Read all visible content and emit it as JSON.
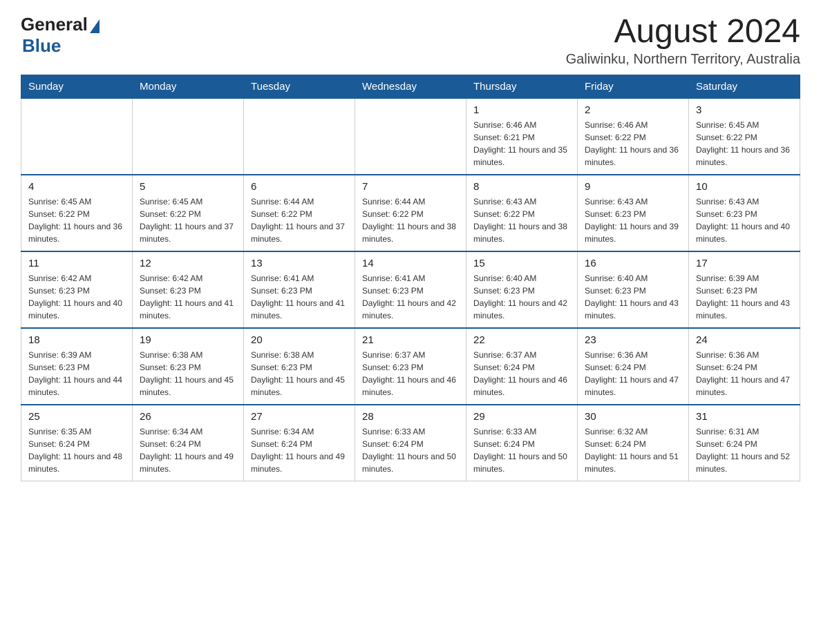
{
  "logo": {
    "general": "General",
    "blue": "Blue"
  },
  "title": {
    "month_year": "August 2024",
    "location": "Galiwinku, Northern Territory, Australia"
  },
  "headers": [
    "Sunday",
    "Monday",
    "Tuesday",
    "Wednesday",
    "Thursday",
    "Friday",
    "Saturday"
  ],
  "weeks": [
    [
      {
        "day": "",
        "info": ""
      },
      {
        "day": "",
        "info": ""
      },
      {
        "day": "",
        "info": ""
      },
      {
        "day": "",
        "info": ""
      },
      {
        "day": "1",
        "info": "Sunrise: 6:46 AM\nSunset: 6:21 PM\nDaylight: 11 hours and 35 minutes."
      },
      {
        "day": "2",
        "info": "Sunrise: 6:46 AM\nSunset: 6:22 PM\nDaylight: 11 hours and 36 minutes."
      },
      {
        "day": "3",
        "info": "Sunrise: 6:45 AM\nSunset: 6:22 PM\nDaylight: 11 hours and 36 minutes."
      }
    ],
    [
      {
        "day": "4",
        "info": "Sunrise: 6:45 AM\nSunset: 6:22 PM\nDaylight: 11 hours and 36 minutes."
      },
      {
        "day": "5",
        "info": "Sunrise: 6:45 AM\nSunset: 6:22 PM\nDaylight: 11 hours and 37 minutes."
      },
      {
        "day": "6",
        "info": "Sunrise: 6:44 AM\nSunset: 6:22 PM\nDaylight: 11 hours and 37 minutes."
      },
      {
        "day": "7",
        "info": "Sunrise: 6:44 AM\nSunset: 6:22 PM\nDaylight: 11 hours and 38 minutes."
      },
      {
        "day": "8",
        "info": "Sunrise: 6:43 AM\nSunset: 6:22 PM\nDaylight: 11 hours and 38 minutes."
      },
      {
        "day": "9",
        "info": "Sunrise: 6:43 AM\nSunset: 6:23 PM\nDaylight: 11 hours and 39 minutes."
      },
      {
        "day": "10",
        "info": "Sunrise: 6:43 AM\nSunset: 6:23 PM\nDaylight: 11 hours and 40 minutes."
      }
    ],
    [
      {
        "day": "11",
        "info": "Sunrise: 6:42 AM\nSunset: 6:23 PM\nDaylight: 11 hours and 40 minutes."
      },
      {
        "day": "12",
        "info": "Sunrise: 6:42 AM\nSunset: 6:23 PM\nDaylight: 11 hours and 41 minutes."
      },
      {
        "day": "13",
        "info": "Sunrise: 6:41 AM\nSunset: 6:23 PM\nDaylight: 11 hours and 41 minutes."
      },
      {
        "day": "14",
        "info": "Sunrise: 6:41 AM\nSunset: 6:23 PM\nDaylight: 11 hours and 42 minutes."
      },
      {
        "day": "15",
        "info": "Sunrise: 6:40 AM\nSunset: 6:23 PM\nDaylight: 11 hours and 42 minutes."
      },
      {
        "day": "16",
        "info": "Sunrise: 6:40 AM\nSunset: 6:23 PM\nDaylight: 11 hours and 43 minutes."
      },
      {
        "day": "17",
        "info": "Sunrise: 6:39 AM\nSunset: 6:23 PM\nDaylight: 11 hours and 43 minutes."
      }
    ],
    [
      {
        "day": "18",
        "info": "Sunrise: 6:39 AM\nSunset: 6:23 PM\nDaylight: 11 hours and 44 minutes."
      },
      {
        "day": "19",
        "info": "Sunrise: 6:38 AM\nSunset: 6:23 PM\nDaylight: 11 hours and 45 minutes."
      },
      {
        "day": "20",
        "info": "Sunrise: 6:38 AM\nSunset: 6:23 PM\nDaylight: 11 hours and 45 minutes."
      },
      {
        "day": "21",
        "info": "Sunrise: 6:37 AM\nSunset: 6:23 PM\nDaylight: 11 hours and 46 minutes."
      },
      {
        "day": "22",
        "info": "Sunrise: 6:37 AM\nSunset: 6:24 PM\nDaylight: 11 hours and 46 minutes."
      },
      {
        "day": "23",
        "info": "Sunrise: 6:36 AM\nSunset: 6:24 PM\nDaylight: 11 hours and 47 minutes."
      },
      {
        "day": "24",
        "info": "Sunrise: 6:36 AM\nSunset: 6:24 PM\nDaylight: 11 hours and 47 minutes."
      }
    ],
    [
      {
        "day": "25",
        "info": "Sunrise: 6:35 AM\nSunset: 6:24 PM\nDaylight: 11 hours and 48 minutes."
      },
      {
        "day": "26",
        "info": "Sunrise: 6:34 AM\nSunset: 6:24 PM\nDaylight: 11 hours and 49 minutes."
      },
      {
        "day": "27",
        "info": "Sunrise: 6:34 AM\nSunset: 6:24 PM\nDaylight: 11 hours and 49 minutes."
      },
      {
        "day": "28",
        "info": "Sunrise: 6:33 AM\nSunset: 6:24 PM\nDaylight: 11 hours and 50 minutes."
      },
      {
        "day": "29",
        "info": "Sunrise: 6:33 AM\nSunset: 6:24 PM\nDaylight: 11 hours and 50 minutes."
      },
      {
        "day": "30",
        "info": "Sunrise: 6:32 AM\nSunset: 6:24 PM\nDaylight: 11 hours and 51 minutes."
      },
      {
        "day": "31",
        "info": "Sunrise: 6:31 AM\nSunset: 6:24 PM\nDaylight: 11 hours and 52 minutes."
      }
    ]
  ]
}
